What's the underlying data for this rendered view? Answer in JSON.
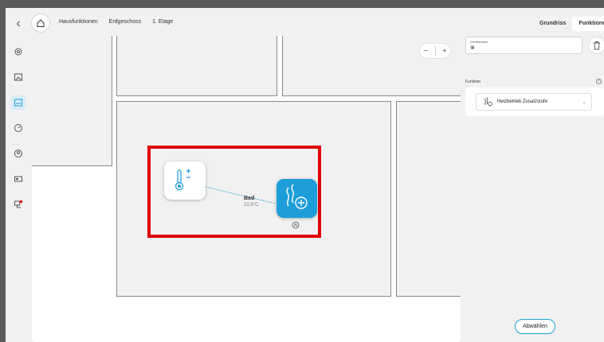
{
  "topbar": {
    "back_icon": "chevron-left-icon",
    "home_icon": "home-icon",
    "breadcrumbs": [
      "Hausfunktionen",
      "Erdgeschoss",
      "1. Etage"
    ],
    "view_toggle": [
      "Grundriss",
      "Funktionen"
    ],
    "active_view": "Funktionen"
  },
  "sidebar": {
    "items": [
      {
        "icon": "gear-icon"
      },
      {
        "icon": "picture-icon"
      },
      {
        "icon": "floorplan-icon",
        "active": true
      },
      {
        "icon": "gauge-icon"
      },
      {
        "icon": "person-icon"
      },
      {
        "icon": "display-icon"
      },
      {
        "icon": "network-alert-icon"
      }
    ]
  },
  "canvas": {
    "zoom_out": "−",
    "zoom_in": "+",
    "sensor": {
      "icon": "thermostat-icon"
    },
    "actor": {
      "icon": "heating-add-icon",
      "color": "#1e9ed8"
    },
    "link_label": "Bad",
    "link_temp": "21.5°C",
    "highlight_color": "#e00000"
  },
  "panel": {
    "field_label": "Gerätename",
    "field_value": "⊗",
    "section_label": "Funktion",
    "function_value": "Heizbetrieb Zusatzstufe",
    "function_icon": "heating-icon",
    "deselect_label": "Abwählen"
  }
}
